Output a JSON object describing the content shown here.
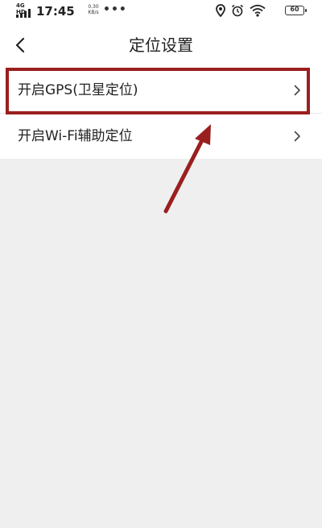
{
  "status_bar": {
    "signal_label": "4G HD",
    "time": "17:45",
    "speed_value": "0.30",
    "speed_unit": "KB/s",
    "dots": "•••",
    "battery": "60"
  },
  "nav": {
    "title": "定位设置"
  },
  "list": {
    "items": [
      {
        "label": "开启GPS(卫星定位)"
      },
      {
        "label": "开启Wi-Fi辅助定位"
      }
    ]
  },
  "colors": {
    "highlight": "#9a1f1f",
    "background": "#efefef"
  }
}
